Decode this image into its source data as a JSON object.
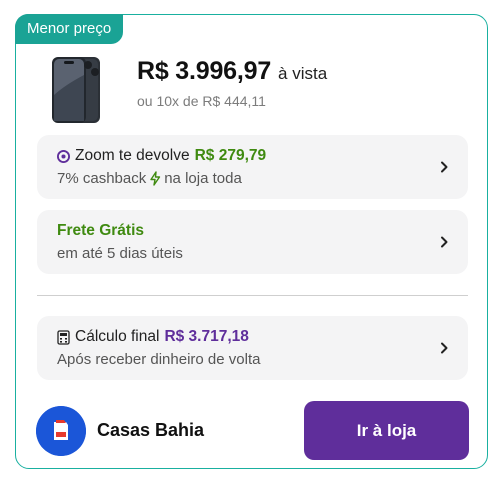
{
  "badge": "Menor preço",
  "offer": {
    "price": "R$ 3.996,97",
    "price_suffix": "à vista",
    "installments": "ou 10x de R$ 444,11"
  },
  "cashback": {
    "label": "Zoom te devolve",
    "amount": "R$ 279,79",
    "percent": "7% cashback",
    "scope": "na loja toda"
  },
  "shipping": {
    "title": "Frete Grátis",
    "delivery": "em até 5 dias úteis"
  },
  "final_calc": {
    "label": "Cálculo final",
    "amount": "R$ 3.717,18",
    "note": "Após receber dinheiro de volta"
  },
  "store": {
    "name": "Casas Bahia",
    "button_label": "Ir à loja"
  },
  "colors": {
    "teal": "#1aa395",
    "purple": "#5f2e9b",
    "green": "#3f8a10",
    "store_blue": "#1b56d8"
  }
}
